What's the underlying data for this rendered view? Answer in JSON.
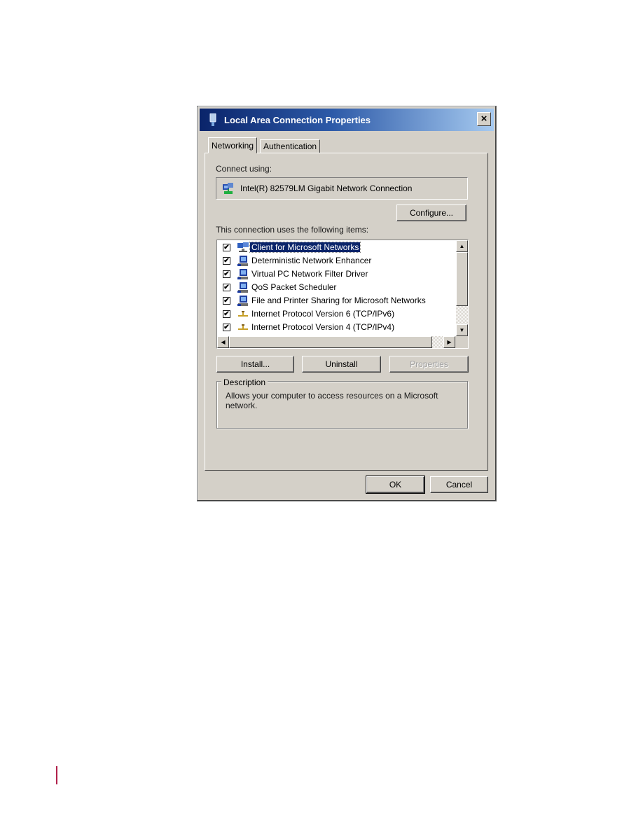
{
  "dialog": {
    "title": "Local Area Connection Properties",
    "close_label": "×",
    "tabs": [
      {
        "label": "Networking",
        "active": true
      },
      {
        "label": "Authentication",
        "active": false
      }
    ],
    "connect_using_label": "Connect using:",
    "adapter_name": "Intel(R) 82579LM Gigabit Network Connection",
    "configure_label": "Configure...",
    "items_label": "This connection uses the following items:",
    "items": [
      {
        "label": "Client for Microsoft Networks",
        "checked": true,
        "icon": "network-client-icon",
        "selected": true
      },
      {
        "label": "Deterministic Network Enhancer",
        "checked": true,
        "icon": "computer-service-icon",
        "selected": false
      },
      {
        "label": "Virtual PC Network Filter Driver",
        "checked": true,
        "icon": "computer-service-icon",
        "selected": false
      },
      {
        "label": "QoS Packet Scheduler",
        "checked": true,
        "icon": "computer-service-icon",
        "selected": false
      },
      {
        "label": "File and Printer Sharing for Microsoft Networks",
        "checked": true,
        "icon": "computer-service-icon",
        "selected": false
      },
      {
        "label": "Internet Protocol Version 6 (TCP/IPv6)",
        "checked": true,
        "icon": "protocol-icon",
        "selected": false
      },
      {
        "label": "Internet Protocol Version 4 (TCP/IPv4)",
        "checked": true,
        "icon": "protocol-icon",
        "selected": false
      }
    ],
    "check_glyph": "✔",
    "install_label": "Install...",
    "uninstall_label": "Uninstall",
    "properties_label": "Properties",
    "description_legend": "Description",
    "description_text": "Allows your computer to access resources on a Microsoft network.",
    "ok_label": "OK",
    "cancel_label": "Cancel",
    "scroll_up": "▲",
    "scroll_down": "▼",
    "scroll_left": "◀",
    "scroll_right": "▶"
  }
}
